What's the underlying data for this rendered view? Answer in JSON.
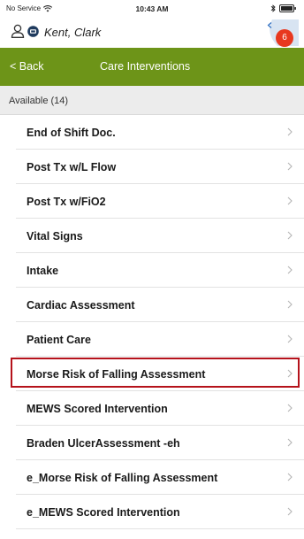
{
  "status_bar": {
    "carrier": "No Service",
    "time": "10:43 AM"
  },
  "patient": {
    "name": "Kent, Clark",
    "alert_count": "6"
  },
  "nav": {
    "back_label": "< Back",
    "title": "Care Interventions"
  },
  "section": {
    "title": "Available (14)"
  },
  "interventions": [
    {
      "label": "End of Shift Doc."
    },
    {
      "label": "Post Tx w/L Flow"
    },
    {
      "label": "Post Tx w/FiO2"
    },
    {
      "label": "Vital Signs"
    },
    {
      "label": "Intake"
    },
    {
      "label": "Cardiac Assessment"
    },
    {
      "label": "Patient Care"
    },
    {
      "label": "Morse Risk of Falling Assessment",
      "highlighted": true
    },
    {
      "label": "MEWS Scored Intervention"
    },
    {
      "label": "Braden UlcerAssessment -eh"
    },
    {
      "label": "e_Morse Risk of Falling Assessment"
    },
    {
      "label": "e_MEWS Scored Intervention"
    }
  ],
  "colors": {
    "nav_bar": "#6d9418",
    "alert_badge": "#e8381f",
    "highlight_border": "#b5121b"
  },
  "icons": {
    "wifi": "wifi-icon",
    "battery": "battery-icon",
    "bluetooth": "bluetooth-icon",
    "person": "person-icon",
    "patient_status": "patient-status-icon",
    "chevron": "chevron-right-icon"
  }
}
